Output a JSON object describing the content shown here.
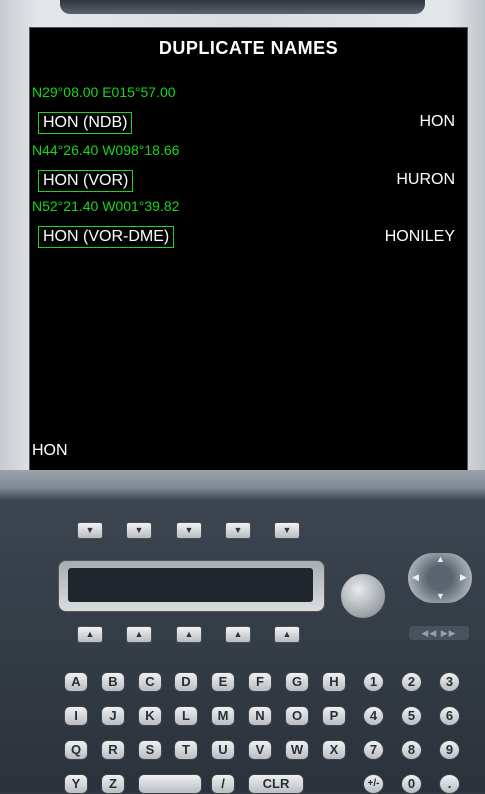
{
  "screen": {
    "title": "DUPLICATE NAMES",
    "entries": [
      {
        "coord": "N29°08.00 E015°57.00",
        "label": "HON (NDB)",
        "name": "HON"
      },
      {
        "coord": "N44°26.40 W098°18.66",
        "label": "HON (VOR)",
        "name": "HURON"
      },
      {
        "coord": "N52°21.40 W001°39.82",
        "label": "HON (VOR-DME)",
        "name": "HONILEY"
      }
    ],
    "scratchpad": "HON"
  },
  "controls": {
    "lsk_up_glyph": "▼",
    "lsk_down_glyph": "▲",
    "skip_label": "◀◀ ▶▶"
  },
  "keyboard": {
    "letters": [
      "A",
      "B",
      "C",
      "D",
      "E",
      "F",
      "G",
      "H",
      "I",
      "J",
      "K",
      "L",
      "M",
      "N",
      "O",
      "P",
      "Q",
      "R",
      "S",
      "T",
      "U",
      "V",
      "W",
      "X",
      "Y",
      "Z"
    ],
    "digits": [
      "1",
      "2",
      "3",
      "4",
      "5",
      "6",
      "7",
      "8",
      "9"
    ],
    "slash": "/",
    "clr": "CLR",
    "plusminus": "+/-",
    "zero": "0",
    "dot": "."
  },
  "colors": {
    "screen_bg": "#000000",
    "coord_text": "#19d619",
    "entry_border": "#1ed41e",
    "text": "#ffffff"
  }
}
